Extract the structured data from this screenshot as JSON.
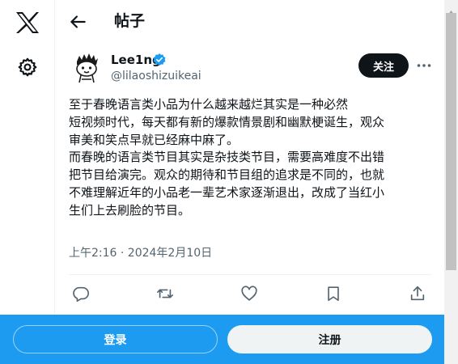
{
  "header": {
    "title": "帖子"
  },
  "post": {
    "author": {
      "name": "Lee1ng",
      "handle": "@lilaoshizuikeai",
      "verified": true
    },
    "follow_label": "关注",
    "paragraphs": [
      "至于春晚语言类小品为什么越来越烂其实是一种必然",
      "短视频时代，每天都有新的爆款情景剧和幽默梗诞生，观众",
      "审美和笑点早就已经麻中麻了。",
      "而春晚的语言类节目其实是杂技类节目，需要高难度不出错",
      "把节目给演完。观众的期待和节目组的追求是不同的，也就",
      "不难理解近年的小品老一辈艺术家逐渐退出，改成了当红小",
      "生们上去刷脸的节目。"
    ],
    "timestamp": "上午2:16 · 2024年2月10日"
  },
  "bottom_bar": {
    "login_label": "登录",
    "signup_label": "注册"
  },
  "icons": {
    "logo": "x-logo-icon",
    "settings": "gear-icon",
    "back": "arrow-left-icon",
    "verified": "verified-badge-icon",
    "more": "more-horizontal-icon",
    "reply": "reply-icon",
    "repost": "repost-icon",
    "like": "heart-icon",
    "bookmark": "bookmark-icon",
    "share": "share-icon"
  },
  "colors": {
    "accent": "#1d9bf0",
    "text": "#0f1419",
    "secondary": "#536471",
    "border": "#eff3f4",
    "follow_bg": "#0f1419"
  }
}
